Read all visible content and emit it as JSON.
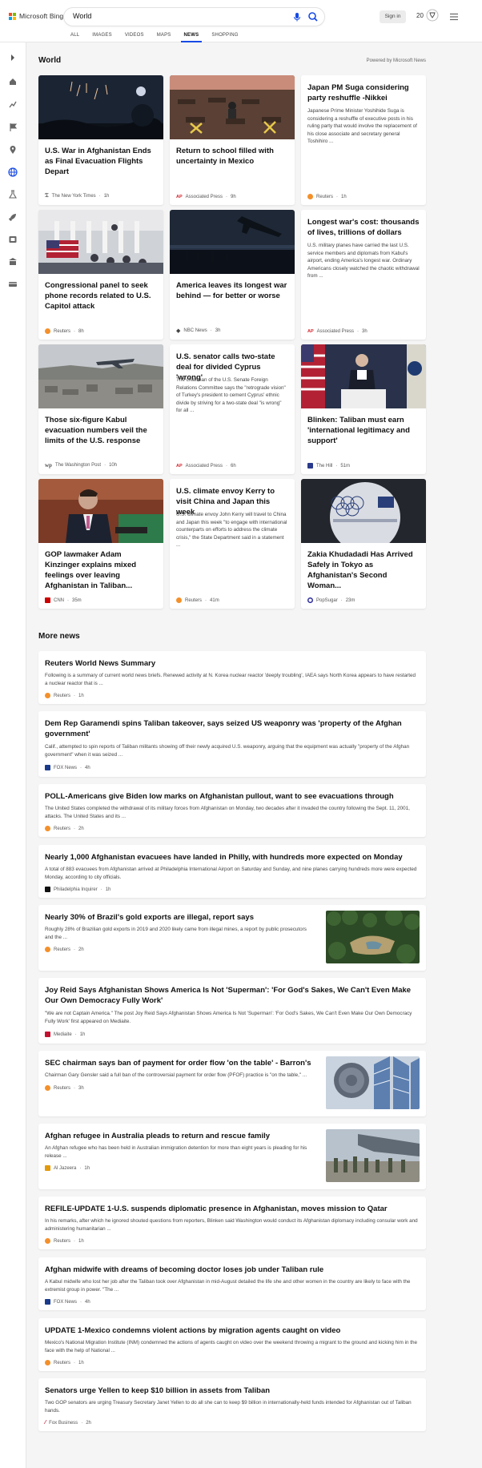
{
  "header": {
    "brand": "Microsoft Bing",
    "query": "World",
    "sign_in": "Sign in",
    "rewards_count": "20",
    "tabs": [
      "ALL",
      "IMAGES",
      "VIDEOS",
      "MAPS",
      "NEWS",
      "SHOPPING"
    ],
    "active_tab": "NEWS"
  },
  "rail": {
    "icons": [
      "chevron-right-icon",
      "home-icon",
      "lab-icon",
      "flag-icon",
      "location-icon",
      "globe-icon",
      "science-icon",
      "rocket-icon",
      "entertainment-icon",
      "money-icon",
      "card-icon"
    ]
  },
  "world": {
    "title": "World",
    "powered_by": "Powered by Microsoft News",
    "cards": [
      {
        "title": "U.S. War in Afghanistan Ends as Final Evacuation Flights Depart",
        "source": "The New York Times",
        "time": "1h",
        "image": "night-fireworks"
      },
      {
        "title": "Return to school filled with uncertainty in Mexico",
        "source": "Associated Press",
        "time": "9h",
        "image": "classroom"
      },
      {
        "title": "Japan PM Suga considering party reshuffle -Nikkei",
        "snippet": "Japanese Prime Minister Yoshihide Suga is considering a reshuffle of executive posts in his ruling party that would involve the replacement of his close associate and secretary general Toshihiro ...",
        "source": "Reuters",
        "time": "1h"
      },
      {
        "title": "Congressional panel to seek phone records related to U.S. Capitol attack",
        "source": "Reuters",
        "time": "8h",
        "image": "capitol-crowd"
      },
      {
        "title": "America leaves its longest war behind — for better or worse",
        "source": "NBC News",
        "time": "3h",
        "image": "plane-night"
      },
      {
        "title": "Longest war's cost: thousands of lives, trillions of dollars",
        "snippet": "U.S. military planes have carried the last U.S. service members and diplomats from Kabul's airport, ending America's longest war. Ordinary Americans closely watched the chaotic withdrawal from ...",
        "source": "Associated Press",
        "time": "3h"
      },
      {
        "title": "Those six-figure Kabul evacuation numbers veil the limits of the U.S. response",
        "source": "The Washington Post",
        "time": "10h",
        "image": "kabul-plane"
      },
      {
        "title": "U.S. senator calls two-state deal for divided Cyprus 'wrong'",
        "snippet": "The chairman of the U.S. Senate Foreign Relations Committee says the \"retrograde vision\" of Turkey's president to cement Cyprus' ethnic divide by striving for a two-state deal \"is wrong\" for all ...",
        "source": "Associated Press",
        "time": "6h"
      },
      {
        "title": "Blinken: Taliban must earn 'international legitimacy and support'",
        "source": "The Hill",
        "time": "51m",
        "image": "blinken-podium"
      },
      {
        "title": "GOP lawmaker Adam Kinzinger explains mixed feelings over leaving Afghanistan in Taliban...",
        "source": "CNN",
        "time": "35m",
        "image": "kinzinger"
      },
      {
        "title": "U.S. climate envoy Kerry to visit China and Japan this week",
        "snippet": "U.S. climate envoy John Kerry will travel to China and Japan this week \"to engage with international counterparts on efforts to address the climate crisis,\" the State Department said in a statement ...",
        "source": "Reuters",
        "time": "41m"
      },
      {
        "title": "Zakia Khudadadi Has Arrived Safely in Tokyo as Afghanistan's Second Woman...",
        "source": "PopSugar",
        "time": "23m",
        "image": "tokyo-2020"
      }
    ]
  },
  "more_news": {
    "title": "More news",
    "items": [
      {
        "title": "Reuters World News Summary",
        "snippet": "Following is a summary of current world news briefs. Renewed activity at N. Korea nuclear reactor 'deeply troubling', IAEA says North Korea appears to have restarted a nuclear reactor that is ...",
        "source": "Reuters",
        "time": "1h"
      },
      {
        "title": "Dem Rep Garamendi spins Taliban takeover, says seized US weaponry was 'property of the Afghan government'",
        "snippet": "Calif., attempted to spin reports of Taliban militants showing off their newly acquired U.S. weaponry, arguing that the equipment was actually \"property of the Afghan government\" when it was seized ...",
        "source": "FOX News",
        "time": "4h"
      },
      {
        "title": "POLL-Americans give Biden low marks on Afghanistan pullout, want to see evacuations through",
        "snippet": "The United States completed the withdrawal of its military forces from Afghanistan on Monday, two decades after it invaded the country following the Sept. 11, 2001, attacks. The United States and its ...",
        "source": "Reuters",
        "time": "2h"
      },
      {
        "title": "Nearly 1,000 Afghanistan evacuees have landed in Philly, with hundreds more expected on Monday",
        "snippet": "A total of 883 evacuees from Afghanistan arrived at Philadelphia International Airport on Saturday and Sunday, and nine planes carrying hundreds more were expected Monday, according to city officials.",
        "source": "Philadelphia Inquirer",
        "time": "1h"
      },
      {
        "title": "Nearly 30% of Brazil's gold exports are illegal, report says",
        "snippet": "Roughly 28% of Brazilian gold exports in 2019 and 2020 likely came from illegal mines, a report by public prosecutors and the ...",
        "source": "Reuters",
        "time": "2h",
        "image": "forest-mine"
      },
      {
        "title": "Joy Reid Says Afghanistan Shows America Is Not 'Superman': 'For God's Sakes, We Can't Even Make Our Own Democracy Fully Work'",
        "snippet": "\"We are not Captain America.\" The post Joy Reid Says Afghanistan Shows America Is Not 'Superman': 'For God's Sakes, We Can't Even Make Our Own Democracy Fully Work' first appeared on Mediaite.",
        "source": "Mediaite",
        "time": "1h"
      },
      {
        "title": "SEC chairman says ban of payment for order flow 'on the table' - Barron's",
        "snippet": "Chairman Gary Gensler said a full ban of the controversial payment for order flow (PFOF) practice is \"on the table,\" ...",
        "source": "Reuters",
        "time": "3h",
        "image": "sec-seal"
      },
      {
        "title": "Afghan refugee in Australia pleads to return and rescue family",
        "snippet": "An Afghan refugee who has been held in Australian immigration detention for more than eight years is pleading for his release ...",
        "source": "Al Jazeera",
        "time": "1h",
        "image": "evacuees-plane"
      },
      {
        "title": "REFILE-UPDATE 1-U.S. suspends diplomatic presence in Afghanistan, moves mission to Qatar",
        "snippet": "In his remarks, after which he ignored shouted questions from reporters, Blinken said Washington would conduct its Afghanistan diplomacy including consular work and administering humanitarian ...",
        "source": "Reuters",
        "time": "1h"
      },
      {
        "title": "Afghan midwife with dreams of becoming doctor loses job under Taliban rule",
        "snippet": "A Kabul midwife who lost her job after the Taliban took over Afghanistan in mid-August detailed the life she and other women in the country are likely to face with the extremist group in power. \"The ...",
        "source": "FOX News",
        "time": "4h"
      },
      {
        "title": "UPDATE 1-Mexico condemns violent actions by migration agents caught on video",
        "snippet": "Mexico's National Migration Institute (INM) condemned the actions of agents caught on video over the weekend throwing a migrant to the ground and kicking him in the face with the help of National ...",
        "source": "Reuters",
        "time": "1h"
      },
      {
        "title": "Senators urge Yellen to keep $10 billion in assets from Taliban",
        "snippet": "Two GOP senators are urging Treasury Secretary Janet Yellen to do all she can to keep $9 billion in internationally-held funds intended for Afghanistan out of Taliban hands.",
        "source": "Fox Business",
        "time": "2h"
      }
    ]
  },
  "colors": {
    "accent": "#174ae4",
    "reuters": "#f4902a",
    "ap": "#d5242c",
    "cnn": "#cc0000",
    "fox": "#1a3b8b",
    "aljazeera": "#e29a0b"
  }
}
